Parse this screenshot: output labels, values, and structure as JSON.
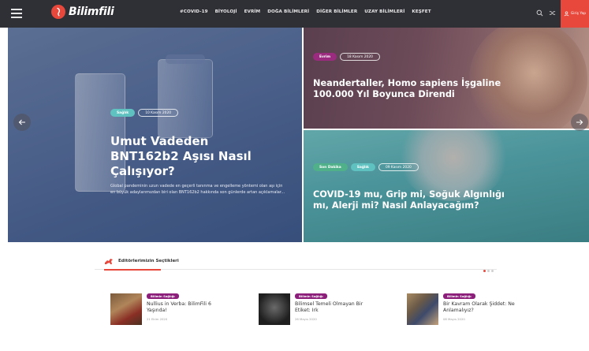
{
  "header": {
    "logo_text": "Bilimfili",
    "nav": [
      "#COVID-19",
      "BİYOLOJİ",
      "EVRİM",
      "DOĞA BİLİMLERİ",
      "DİĞER BİLİMLER",
      "UZAY BİLİMLERİ",
      "KEŞFET"
    ],
    "login_label": "Giriş Yap",
    "icons": [
      "menu-icon",
      "search-icon",
      "shuffle-icon",
      "user-icon"
    ]
  },
  "hero": {
    "main": {
      "tags": [
        "Sağlık"
      ],
      "date": "10 Kasım 2020",
      "title": "Umut Vadeden BNT162b2 Aşısı Nasıl Çalışıyor?",
      "excerpt": "Global pandeminin uzun vadede en geçerli tanınma ve engelleme yöntemi olan aşı için en büyük adaylarımızdan biri olan BNT162b2 hakkında son günlerde artan açıklamalar..."
    },
    "top_right": {
      "tags": [
        "Evrim"
      ],
      "date": "18 Kasım 2020",
      "title": "Neandertaller, Homo sapiens İşgaline 100.000 Yıl Boyunca Direndi"
    },
    "bottom_right": {
      "tags": [
        "Son Dakika",
        "Sağlık"
      ],
      "date": "09 Kasım 2020",
      "title": "COVID-19 mu, Grip mi, Soğuk Algınlığı mı, Alerji mi? Nasıl Anlayacağım?"
    }
  },
  "picks": {
    "title": "Editörlerimizin Seçtikleri",
    "cards": [
      {
        "tag": "Bilimin Sağlığı",
        "title": "Nullius in Verba: BilimFili 6 Yaşında!",
        "date": "21 Ekim 2020"
      },
      {
        "tag": "Bilimin Sağlığı",
        "title": "Bilimsel Temeli Olmayan Bir Etiket: Irk",
        "date": "26 Mayıs 2020"
      },
      {
        "tag": "Bilimin Sağlığı",
        "title": "Bir Kavram Olarak Şiddet: Ne Anlamalıyız?",
        "date": "08 Mayıs 2020"
      }
    ]
  },
  "colors": {
    "topbar": "#2f2f36",
    "accent": "#e8473c",
    "tag_teal": "#5fc2c0",
    "tag_magenta": "#9b2b7f",
    "tag_green": "#4fb08a",
    "card_tag": "#8b1f7a"
  }
}
